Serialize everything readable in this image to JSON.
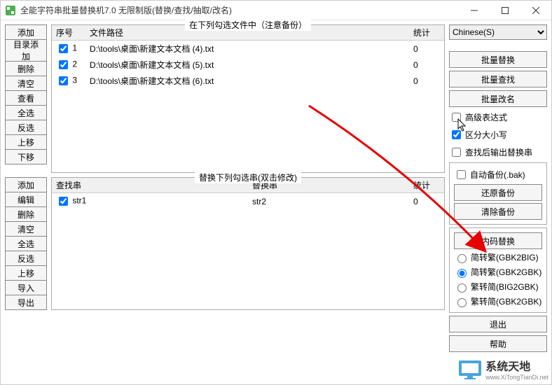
{
  "title": "全能字符串批量替换机7.0 无限制版(替换/查找/抽取/改名)",
  "left_top_buttons": [
    "添加",
    "目录添加",
    "删除",
    "清空",
    "查看",
    "全选",
    "反选",
    "上移",
    "下移"
  ],
  "left_bottom_buttons": [
    "添加",
    "编辑",
    "删除",
    "清空",
    "全选",
    "反选",
    "上移",
    "导入",
    "导出"
  ],
  "top_fieldset_legend": "在下列勾选文件中（注意备份）",
  "bottom_fieldset_legend": "替换下列勾选串(双击修改)",
  "file_table": {
    "headers": {
      "seq": "序号",
      "path": "文件路径",
      "stat": "统计"
    },
    "rows": [
      {
        "checked": true,
        "seq": "1",
        "path": "D:\\tools\\桌面\\新建文本文档 (4).txt",
        "stat": "0"
      },
      {
        "checked": true,
        "seq": "2",
        "path": "D:\\tools\\桌面\\新建文本文档 (5).txt",
        "stat": "0"
      },
      {
        "checked": true,
        "seq": "3",
        "path": "D:\\tools\\桌面\\新建文本文档 (6).txt",
        "stat": "0"
      }
    ]
  },
  "replace_table": {
    "headers": {
      "find": "查找串",
      "replace": "替换串",
      "stat": "统计"
    },
    "rows": [
      {
        "checked": true,
        "find": "str1",
        "replace": "str2",
        "stat": "0"
      }
    ]
  },
  "right": {
    "encoding_selected": "Chinese(S)",
    "batch_replace": "批量替换",
    "batch_find": "批量查找",
    "batch_rename": "批量改名",
    "opt_advanced": "高级表达式",
    "opt_case": "区分大小写",
    "opt_output": "查找后输出替换串",
    "opt_autobak": "自动备份(.bak)",
    "restore_bak": "还原备份",
    "clear_bak": "清除备份",
    "encode_replace": "内码替换",
    "enc_opts": [
      "简转繁(GBK2BIG)",
      "简转繁(GBK2GBK)",
      "繁转简(BIG2GBK)",
      "繁转简(GBK2GBK)"
    ],
    "enc_selected_index": 1,
    "exit": "退出",
    "help": "帮助"
  },
  "checks": {
    "advanced": false,
    "case": true,
    "output": false,
    "autobak": false
  },
  "watermark": {
    "main": "系统天地",
    "sub": "www.XiTongTianDi.net"
  }
}
